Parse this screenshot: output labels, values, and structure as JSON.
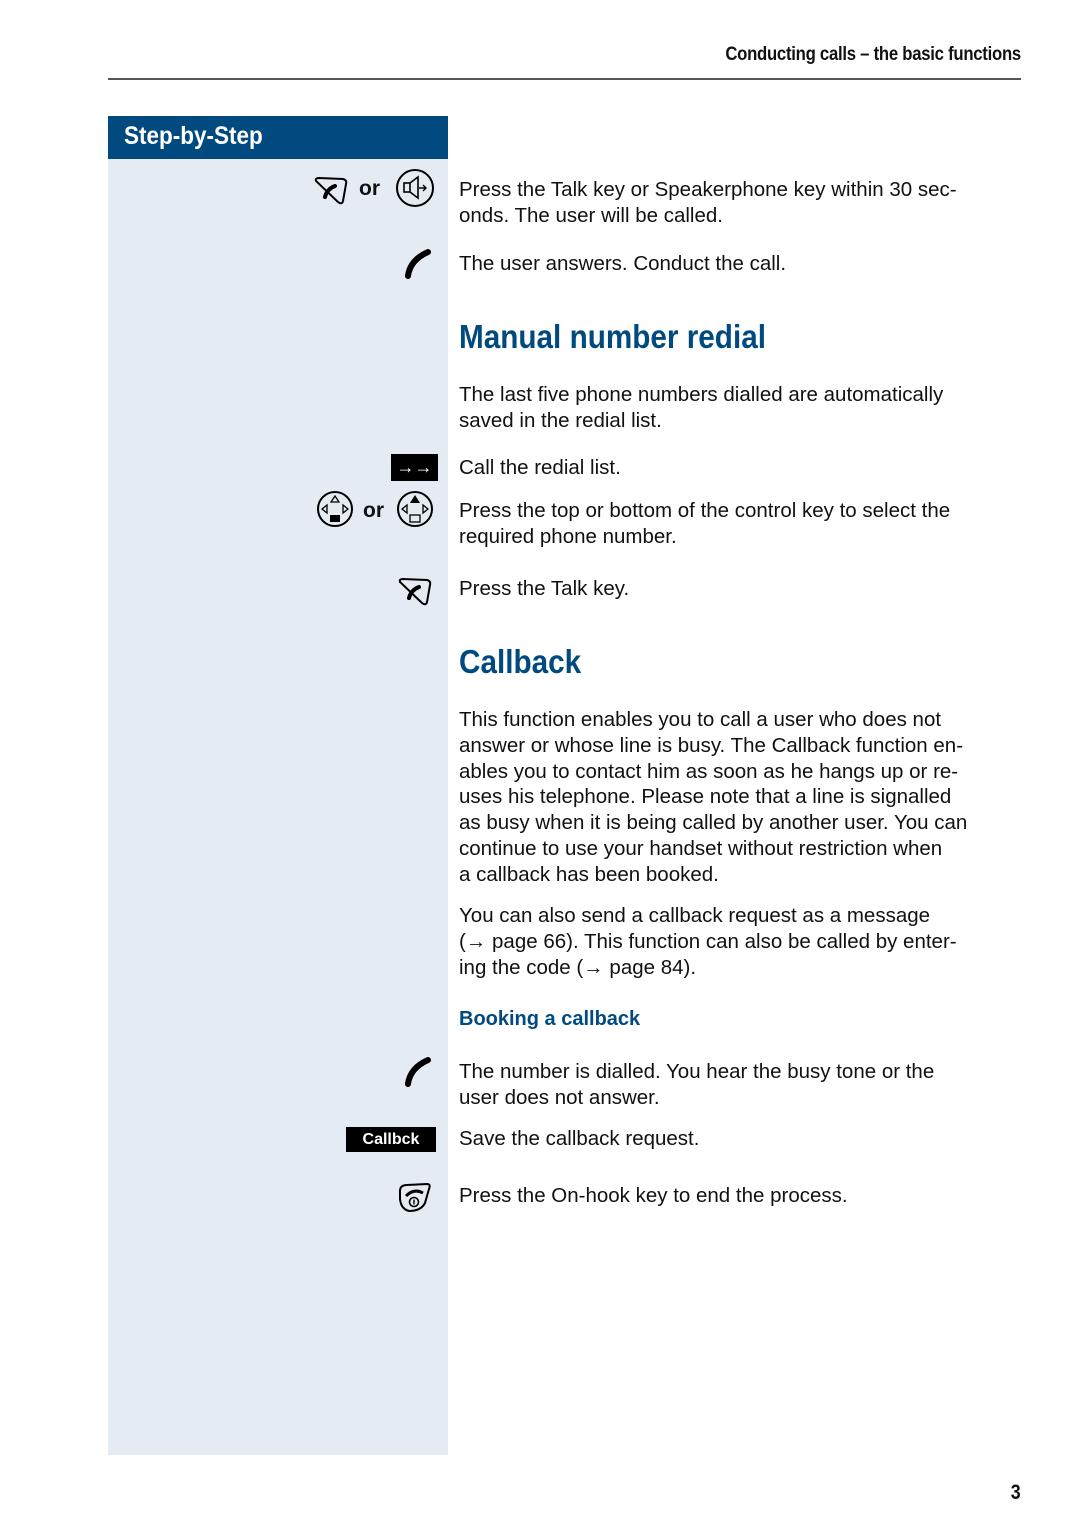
{
  "header": {
    "title": "Conducting calls – the basic functions"
  },
  "sidebar": {
    "title": "Step-by-Step",
    "or_label": "or",
    "redial_key": "→→",
    "softkey_callback": "Callbck"
  },
  "intro": {
    "step1": "Press the Talk key or Speakerphone key within 30 sec-onds. The user will be called.",
    "step1_lines": [
      "Press the Talk key or Speakerphone key within 30 sec-",
      "onds. The user will be called."
    ],
    "step2": "The user answers. Conduct the call."
  },
  "manual_redial": {
    "heading": "Manual number redial",
    "intro_lines": [
      "The last five phone numbers dialled are automatically",
      "saved in the redial list."
    ],
    "step1": "Call the redial list.",
    "step2_lines": [
      "Press the top or bottom of the control key to select the",
      "required phone number."
    ],
    "step3": "Press the Talk key."
  },
  "callback": {
    "heading": "Callback",
    "para1_lines": [
      "This function enables you to call a user who does not",
      "answer or whose line is busy. The Callback function en-",
      "ables you to contact him as soon as he hangs up or re-",
      "uses his telephone. Please note that a line is signalled",
      "as busy when it is being called by another user. You can",
      "continue to use your handset without restriction when",
      "a callback has been booked."
    ],
    "para2_lines": [
      "You can also send a callback request as a message",
      "(→ page 66). This function can also be called by enter-",
      "ing the code (→ page 84)."
    ],
    "subheading": "Booking a callback",
    "steps": {
      "dial_lines": [
        "The number is dialled. You hear the busy tone or the",
        "user does not answer."
      ],
      "save": "Save the callback request.",
      "end": "Press the On-hook key to end the process."
    }
  },
  "footer": {
    "page_number": "3"
  },
  "colors": {
    "accent": "#004a7f",
    "sidebar_bg": "#e5ebf2"
  }
}
